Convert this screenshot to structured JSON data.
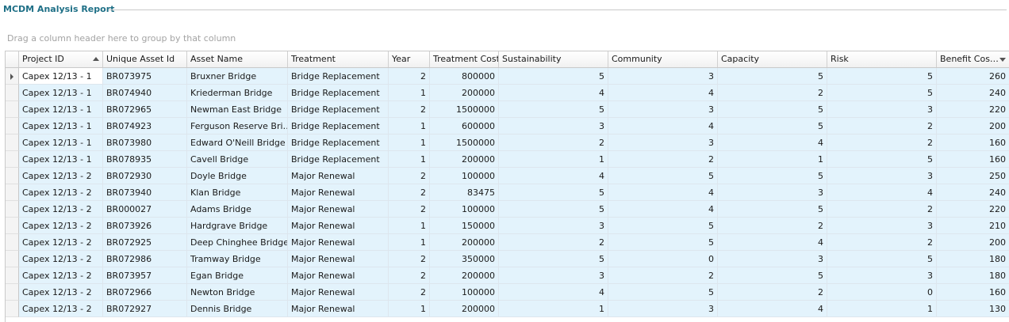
{
  "report": {
    "title": "MCDM Analysis Report"
  },
  "group_panel": {
    "hint": "Drag a column header here to group by that column"
  },
  "columns": [
    "Project ID",
    "Unique Asset Id",
    "Asset Name",
    "Treatment",
    "Year",
    "Treatment Cost",
    "Sustainability",
    "Community",
    "Capacity",
    "Risk",
    "Benefit Cos…"
  ],
  "sort": {
    "ascending_column": "Project ID",
    "descending_column": "Benefit Cos…"
  },
  "rows": [
    [
      "Capex 12/13 - 1",
      "BR073975",
      "Bruxner Bridge",
      "Bridge Replacement",
      "2",
      "800000",
      "5",
      "3",
      "5",
      "5",
      "260"
    ],
    [
      "Capex 12/13 - 1",
      "BR074940",
      "Kriederman Bridge",
      "Bridge Replacement",
      "1",
      "200000",
      "4",
      "4",
      "2",
      "5",
      "240"
    ],
    [
      "Capex 12/13 - 1",
      "BR072965",
      "Newman East Bridge",
      "Bridge Replacement",
      "2",
      "1500000",
      "5",
      "3",
      "5",
      "3",
      "220"
    ],
    [
      "Capex 12/13 - 1",
      "BR074923",
      "Ferguson Reserve Bri…",
      "Bridge Replacement",
      "1",
      "600000",
      "3",
      "4",
      "5",
      "2",
      "200"
    ],
    [
      "Capex 12/13 - 1",
      "BR073980",
      "Edward O'Neill Bridge",
      "Bridge Replacement",
      "1",
      "1500000",
      "2",
      "3",
      "4",
      "2",
      "160"
    ],
    [
      "Capex 12/13 - 1",
      "BR078935",
      "Cavell Bridge",
      "Bridge Replacement",
      "1",
      "200000",
      "1",
      "2",
      "1",
      "5",
      "160"
    ],
    [
      "Capex 12/13 - 2",
      "BR072930",
      "Doyle Bridge",
      "Major Renewal",
      "2",
      "100000",
      "4",
      "5",
      "5",
      "3",
      "250"
    ],
    [
      "Capex 12/13 - 2",
      "BR073940",
      "Klan Bridge",
      "Major Renewal",
      "2",
      "83475",
      "5",
      "4",
      "3",
      "4",
      "240"
    ],
    [
      "Capex 12/13 - 2",
      "BR000027",
      "Adams Bridge",
      "Major Renewal",
      "2",
      "100000",
      "5",
      "4",
      "5",
      "2",
      "220"
    ],
    [
      "Capex 12/13 - 2",
      "BR073926",
      "Hardgrave Bridge",
      "Major Renewal",
      "1",
      "150000",
      "3",
      "5",
      "2",
      "3",
      "210"
    ],
    [
      "Capex 12/13 - 2",
      "BR072925",
      "Deep Chinghee Bridge",
      "Major Renewal",
      "1",
      "200000",
      "2",
      "5",
      "4",
      "2",
      "200"
    ],
    [
      "Capex 12/13 - 2",
      "BR072986",
      "Tramway Bridge",
      "Major Renewal",
      "2",
      "350000",
      "5",
      "0",
      "3",
      "5",
      "180"
    ],
    [
      "Capex 12/13 - 2",
      "BR073957",
      "Egan Bridge",
      "Major Renewal",
      "2",
      "200000",
      "3",
      "2",
      "5",
      "3",
      "180"
    ],
    [
      "Capex 12/13 - 2",
      "BR072966",
      "Newton Bridge",
      "Major Renewal",
      "2",
      "100000",
      "4",
      "5",
      "2",
      "0",
      "160"
    ],
    [
      "Capex 12/13 - 2",
      "BR072927",
      "Dennis Bridge",
      "Major Renewal",
      "1",
      "200000",
      "1",
      "3",
      "4",
      "1",
      "130"
    ]
  ],
  "colors": {
    "title": "#1e6f86",
    "row_background": "#e3f3fc",
    "selected_row_background": "#ffffff"
  }
}
